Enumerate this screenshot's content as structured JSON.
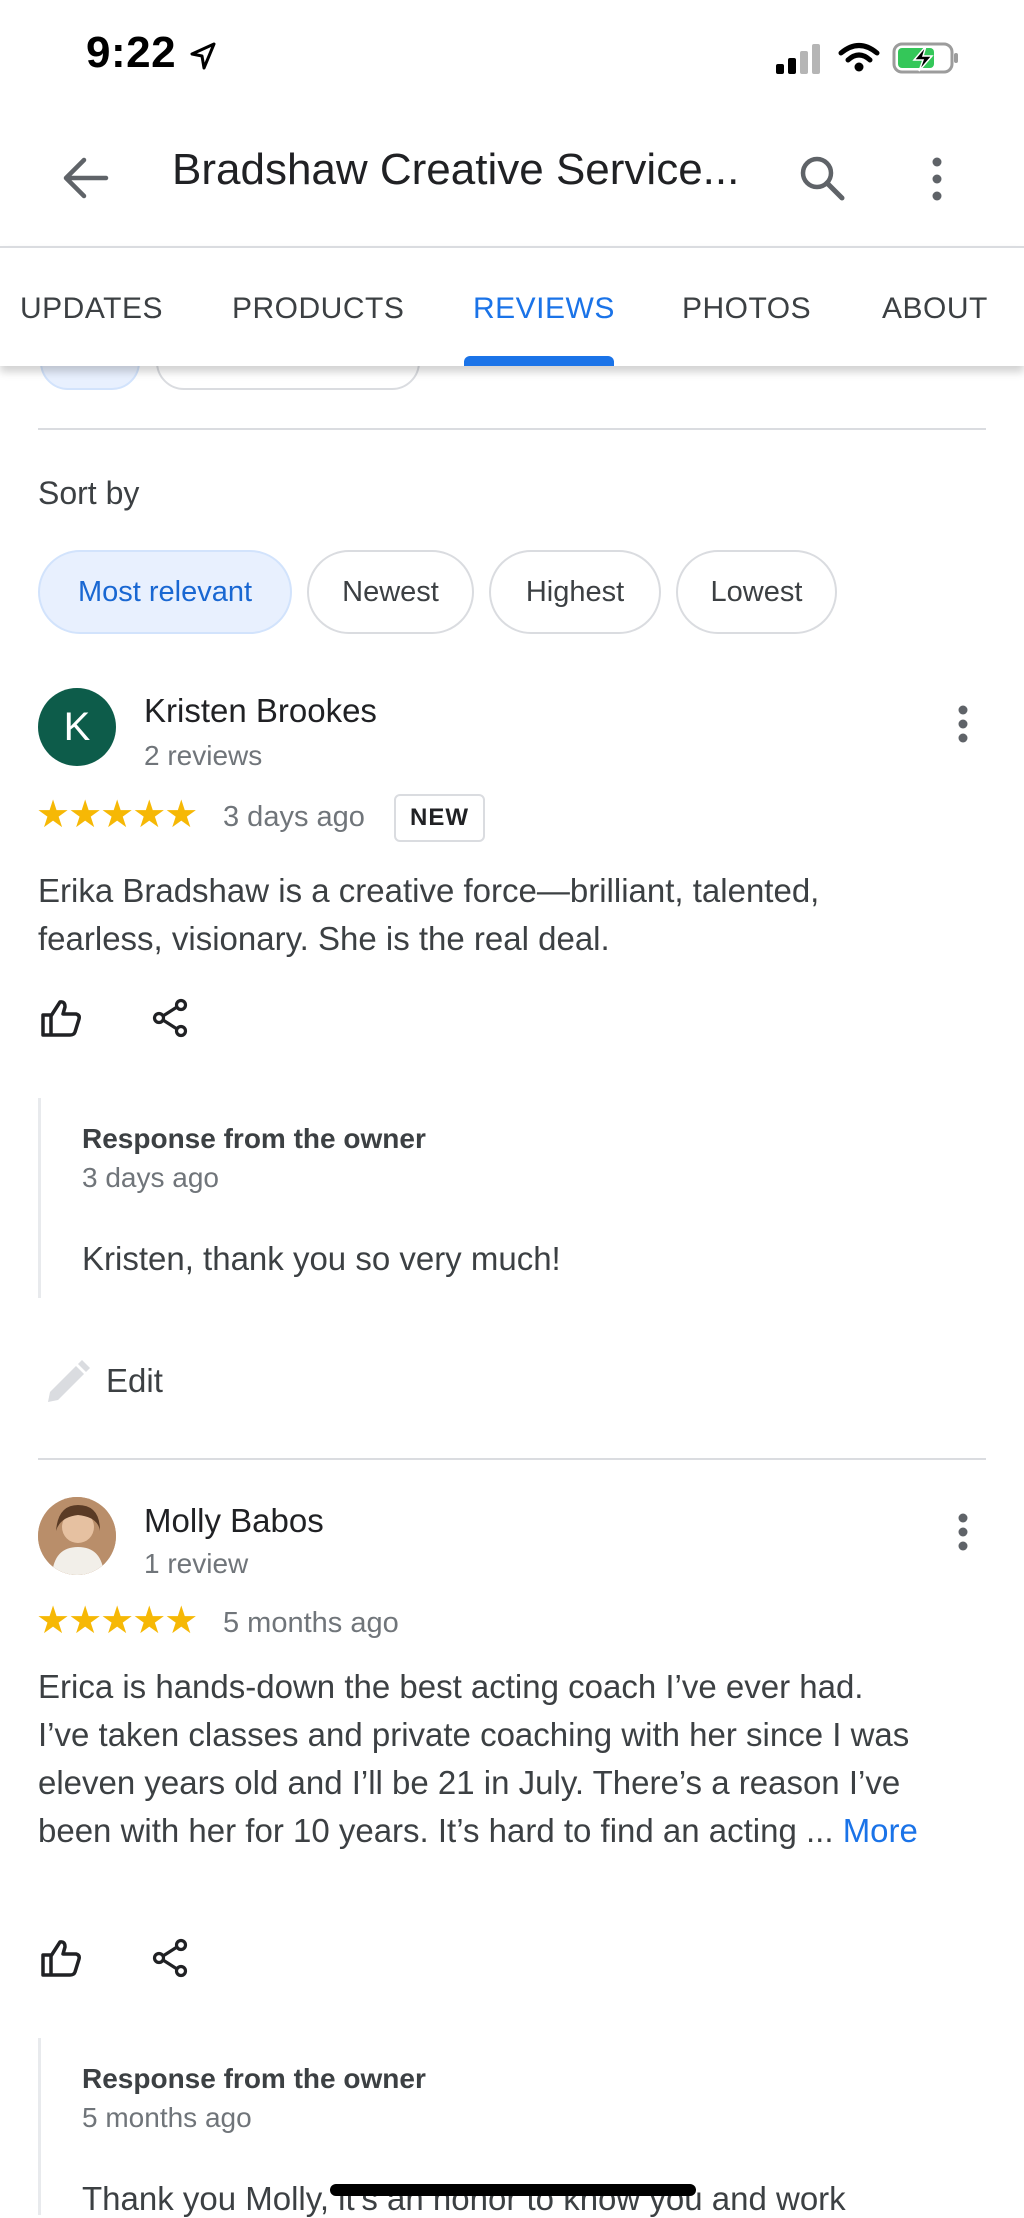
{
  "status_bar": {
    "time": "9:22"
  },
  "header": {
    "title": "Bradshaw Creative Service..."
  },
  "tabs": [
    {
      "label": "UPDATES"
    },
    {
      "label": "PRODUCTS"
    },
    {
      "label": "REVIEWS",
      "active": true
    },
    {
      "label": "PHOTOS"
    },
    {
      "label": "ABOUT"
    }
  ],
  "sort": {
    "label": "Sort by",
    "options": [
      {
        "label": "Most relevant",
        "selected": true
      },
      {
        "label": "Newest"
      },
      {
        "label": "Highest"
      },
      {
        "label": "Lowest"
      }
    ]
  },
  "reviews": [
    {
      "initial": "K",
      "name": "Kristen Brookes",
      "count": "2 reviews",
      "rating": 5,
      "stars": "★★★★★",
      "time": "3 days ago",
      "badge": "NEW",
      "text": "Erika Bradshaw is a creative force—brilliant, talented, fearless, visionary. She is the real deal.",
      "response": {
        "title": "Response from the owner",
        "time": "3 days ago",
        "text": "Kristen, thank you so very much!"
      }
    },
    {
      "name": "Molly Babos",
      "count": "1 review",
      "rating": 5,
      "stars": "★★★★★",
      "time": "5 months ago",
      "text": "Erica is hands-down the best acting coach I’ve ever had. I’ve taken classes and private coaching with her since I was eleven years old and I’ll be 21 in July. There’s a reason I’ve been with her for 10 years. It’s hard to find an acting ...",
      "more_label": "More",
      "response": {
        "title": "Response from the owner",
        "time": "5 months ago",
        "text": "Thank you Molly, it’s an honor to know you and work"
      }
    }
  ],
  "edit_label": "Edit",
  "colors": {
    "accent": "#1a73e8",
    "star": "#f6b805",
    "avatar_k": "#0d5c4a",
    "chip_selected_bg": "#e8f0fe"
  },
  "icons": [
    "location-arrow-icon",
    "signal-icon",
    "wifi-icon",
    "battery-charging-icon",
    "back-arrow-icon",
    "search-icon",
    "more-vert-icon",
    "thumbs-up-icon",
    "share-icon",
    "pencil-icon"
  ]
}
